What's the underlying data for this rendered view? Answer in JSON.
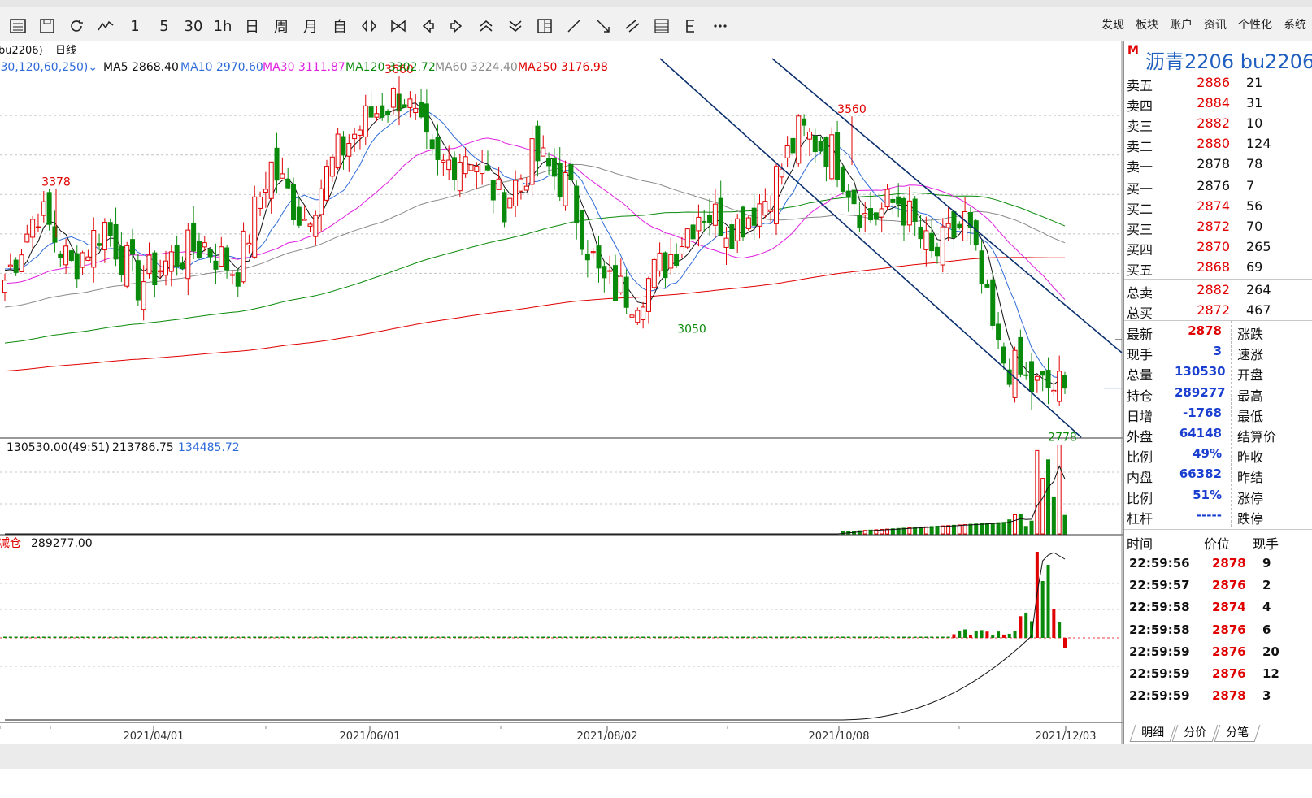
{
  "toolbar": {
    "periods": [
      "1",
      "5",
      "30",
      "1h",
      "日",
      "周",
      "月",
      "自"
    ],
    "menu": [
      "发现",
      "板块",
      "账户",
      "资讯",
      "个性化",
      "系统"
    ]
  },
  "chart_header": {
    "symbol_label": "bu2206)",
    "period_label": "日线",
    "ma_params": ",30,120,60,250)",
    "ma_labels": [
      {
        "text": "MA5 2868.40",
        "color": "#111111"
      },
      {
        "text": "MA10 2970.60",
        "color": "#2e6bd9"
      },
      {
        "text": "MA30 3111.87",
        "color": "#e020e0"
      },
      {
        "text": "MA120 3302.72",
        "color": "#0a8a0a"
      },
      {
        "text": "MA60 3224.40",
        "color": "#8a8a8a"
      },
      {
        "text": "MA250 3176.98",
        "color": "#e00000"
      }
    ]
  },
  "volume_header": {
    "v1": "130530.00(49:51)",
    "v2": "213786.75",
    "v3": "134485.72"
  },
  "oi_header": {
    "label": "减仓",
    "value": "289277.00"
  },
  "chart_data": [
    {
      "type": "candlestick",
      "title": "",
      "xlabel": "",
      "ylabel": "",
      "x_ticks": [
        "2021/04/01",
        "2021/06/01",
        "2021/08/02",
        "2021/10/08",
        "2021/12/03"
      ],
      "ylim": [
        2755,
        3705
      ],
      "grid": true,
      "annotations": [
        {
          "label": "3378",
          "value": 3378,
          "color": "#e00000"
        },
        {
          "label": "3660",
          "value": 3660,
          "color": "#e00000"
        },
        {
          "label": "3560",
          "value": 3560,
          "color": "#e00000"
        },
        {
          "label": "3050",
          "value": 3050,
          "color": "#0a8a0a"
        },
        {
          "label": "2778",
          "value": 2778,
          "color": "#0a8a0a"
        }
      ],
      "series": [
        {
          "name": "MA5",
          "value": 2868.4
        },
        {
          "name": "MA10",
          "value": 2970.6
        },
        {
          "name": "MA30",
          "value": 3111.87
        },
        {
          "name": "MA120",
          "value": 3302.72
        },
        {
          "name": "MA60",
          "value": 3224.4
        },
        {
          "name": "MA250",
          "value": 3176.98
        }
      ],
      "anchors": [
        3150,
        3330,
        3180,
        3290,
        3140,
        3200,
        3240,
        3170,
        3440,
        3300,
        3460,
        3560,
        3620,
        3420,
        3480,
        3340,
        3460,
        3380,
        3140,
        3110,
        3200,
        3330,
        3280,
        3360,
        3520,
        3470,
        3300,
        3350,
        3200,
        3300,
        2960,
        2880,
        2878
      ],
      "last_close": 2878
    },
    {
      "type": "bar",
      "title": "",
      "values": [
        130530,
        213786.75,
        134485.72
      ],
      "labels": [
        "130530.00(49:51)",
        "213786.75",
        "134485.72"
      ]
    },
    {
      "type": "bar",
      "title": "",
      "values": [
        289277
      ],
      "labels": [
        "减仓",
        "289277.00"
      ]
    }
  ],
  "right_panel": {
    "title_marker": "M",
    "title": "沥青2206  bu2206",
    "sell": [
      {
        "label": "卖五",
        "price": "2886",
        "vol": "21"
      },
      {
        "label": "卖四",
        "price": "2884",
        "vol": "31"
      },
      {
        "label": "卖三",
        "price": "2882",
        "vol": "10"
      },
      {
        "label": "卖二",
        "price": "2880",
        "vol": "124"
      },
      {
        "label": "卖一",
        "price": "2878",
        "vol": "78"
      }
    ],
    "buy": [
      {
        "label": "买一",
        "price": "2876",
        "vol": "7"
      },
      {
        "label": "买二",
        "price": "2874",
        "vol": "56"
      },
      {
        "label": "买三",
        "price": "2872",
        "vol": "70"
      },
      {
        "label": "买四",
        "price": "2870",
        "vol": "265"
      },
      {
        "label": "买五",
        "price": "2868",
        "vol": "69"
      }
    ],
    "totals": [
      {
        "label": "总卖",
        "price": "2882",
        "vol": "264"
      },
      {
        "label": "总买",
        "price": "2872",
        "vol": "467"
      }
    ],
    "quote": [
      {
        "l": "最新",
        "v": "2878",
        "color": "#e00000",
        "r": "涨跌"
      },
      {
        "l": "现手",
        "v": "3",
        "color": "#1a3fd0",
        "r": "速涨"
      },
      {
        "l": "总量",
        "v": "130530",
        "color": "#1a3fd0",
        "r": "开盘"
      },
      {
        "l": "持仓",
        "v": "289277",
        "color": "#1a3fd0",
        "r": "最高"
      },
      {
        "l": "日增",
        "v": "-1768",
        "color": "#1a3fd0",
        "r": "最低"
      },
      {
        "l": "外盘",
        "v": "64148",
        "color": "#1a3fd0",
        "r": "结算价"
      },
      {
        "l": "比例",
        "v": "49%",
        "color": "#1a3fd0",
        "r": "昨收"
      },
      {
        "l": "内盘",
        "v": "66382",
        "color": "#1a3fd0",
        "r": "昨结"
      },
      {
        "l": "比例",
        "v": "51%",
        "color": "#1a3fd0",
        "r": "涨停"
      },
      {
        "l": "杠杆",
        "v": "-----",
        "color": "#1a3fd0",
        "r": "跌停"
      }
    ],
    "ticks_header": {
      "time": "时间",
      "price": "价位",
      "qty": "现手"
    },
    "ticks": [
      {
        "time": "22:59:56",
        "price": "2878",
        "qty": "9"
      },
      {
        "time": "22:59:57",
        "price": "2876",
        "qty": "2"
      },
      {
        "time": "22:59:58",
        "price": "2874",
        "qty": "4"
      },
      {
        "time": "22:59:58",
        "price": "2876",
        "qty": "6"
      },
      {
        "time": "22:59:59",
        "price": "2876",
        "qty": "20"
      },
      {
        "time": "22:59:59",
        "price": "2876",
        "qty": "12"
      },
      {
        "time": "22:59:59",
        "price": "2878",
        "qty": "3"
      }
    ],
    "tabs": [
      "明细",
      "分价",
      "分笔"
    ]
  },
  "colors": {
    "up": "#e00000",
    "down": "#0a8a0a",
    "channel": "#0a2f6e"
  }
}
